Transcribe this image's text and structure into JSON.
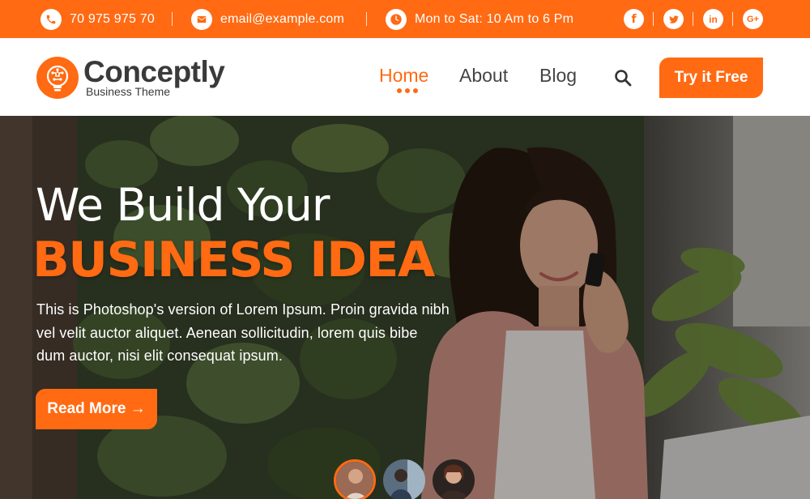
{
  "topbar": {
    "phone": "70 975 975 70",
    "email": "email@example.com",
    "hours": "Mon to Sat: 10 Am to 6 Pm",
    "social": [
      {
        "icon": "facebook-icon",
        "glyph": "f"
      },
      {
        "icon": "twitter-icon",
        "glyph": "t"
      },
      {
        "icon": "linkedin-icon",
        "glyph": "in"
      },
      {
        "icon": "google-plus-icon",
        "glyph": "G+"
      }
    ]
  },
  "header": {
    "logo_title": "Conceptly",
    "logo_subtitle": "Business Theme",
    "nav": [
      "Home",
      "About",
      "Blog"
    ],
    "active_nav": "Home",
    "cta_label": "Try it Free"
  },
  "hero": {
    "title_line1": "We Build Your",
    "title_line2": "BUSINESS IDEA",
    "description_line1": "This is Photoshop's version  of Lorem Ipsum. Proin gravida nibh",
    "description_line2": "vel velit auctor aliquet. Aenean sollicitudin, lorem quis bibe",
    "description_line3": "dum auctor, nisi elit consequat ipsum.",
    "button_label": "Read More →",
    "active_slide": 1,
    "slide_count": 3
  },
  "colors": {
    "accent": "#ff6a13",
    "text_dark": "#3a3a3a",
    "white": "#ffffff"
  }
}
